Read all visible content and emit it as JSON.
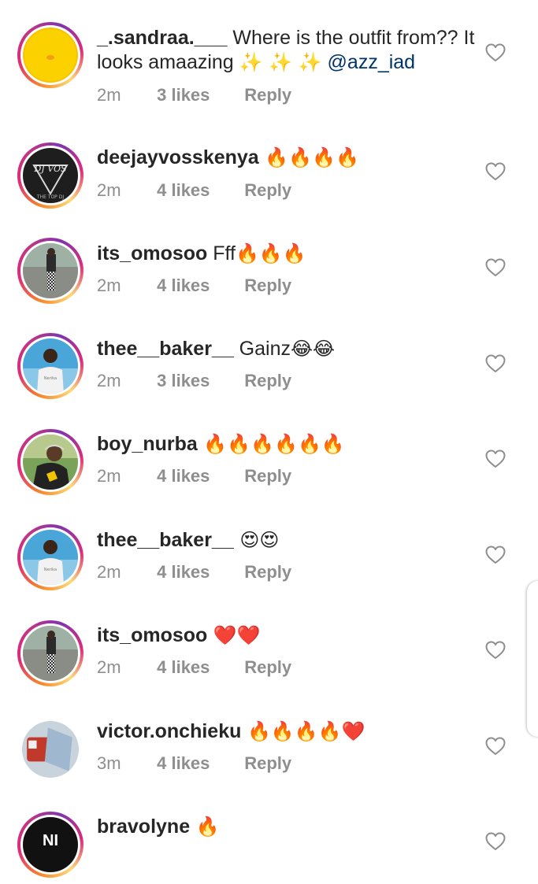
{
  "comments": [
    {
      "username": "_.sandraa.___",
      "text": " Where is the outfit from?? It looks amaazing",
      "emoji": "✨ ✨ ✨",
      "mention": "@azz_iad",
      "time": "2m",
      "likes": "3 likes",
      "reply": "Reply",
      "avatar": "yellow-avatar"
    },
    {
      "username": "deejayvosskenya",
      "text": "",
      "emoji": " 🔥🔥🔥🔥",
      "mention": "",
      "time": "2m",
      "likes": "4 likes",
      "reply": "Reply",
      "avatar": "dj-logo-avatar"
    },
    {
      "username": "its_omosoo",
      "text": " Fff",
      "emoji": "🔥🔥🔥",
      "mention": "",
      "time": "2m",
      "likes": "4 likes",
      "reply": "Reply",
      "avatar": "person-road-avatar"
    },
    {
      "username": "thee__baker__",
      "text": " Gainz",
      "emoji": "😂😂",
      "mention": "",
      "time": "2m",
      "likes": "3 likes",
      "reply": "Reply",
      "avatar": "person-beach-avatar"
    },
    {
      "username": "boy_nurba",
      "text": "",
      "emoji": " 🔥🔥🔥🔥🔥🔥",
      "mention": "",
      "time": "2m",
      "likes": "4 likes",
      "reply": "Reply",
      "avatar": "person-cap-avatar"
    },
    {
      "username": "thee__baker__",
      "text": "",
      "emoji": " 😍😍",
      "mention": "",
      "time": "2m",
      "likes": "4 likes",
      "reply": "Reply",
      "avatar": "person-beach-avatar"
    },
    {
      "username": "its_omosoo",
      "text": "",
      "emoji": " ❤️❤️",
      "mention": "",
      "time": "2m",
      "likes": "4 likes",
      "reply": "Reply",
      "avatar": "person-road-avatar"
    },
    {
      "username": "victor.onchieku",
      "text": "",
      "emoji": " 🔥🔥🔥🔥❤️",
      "mention": "",
      "time": "3m",
      "likes": "4 likes",
      "reply": "Reply",
      "avatar": "red-object-avatar"
    },
    {
      "username": "bravolyne",
      "text": "",
      "emoji": " 🔥",
      "mention": "",
      "time": "",
      "likes": "",
      "reply": "",
      "avatar": "black-logo-avatar",
      "avatar_text": "NI"
    }
  ],
  "colors": {
    "username": "#262626",
    "meta": "#8e8e8e",
    "mention": "#003569",
    "heart_outline": "#8e8e8e"
  },
  "icons": {
    "like": "heart-outline-icon"
  }
}
